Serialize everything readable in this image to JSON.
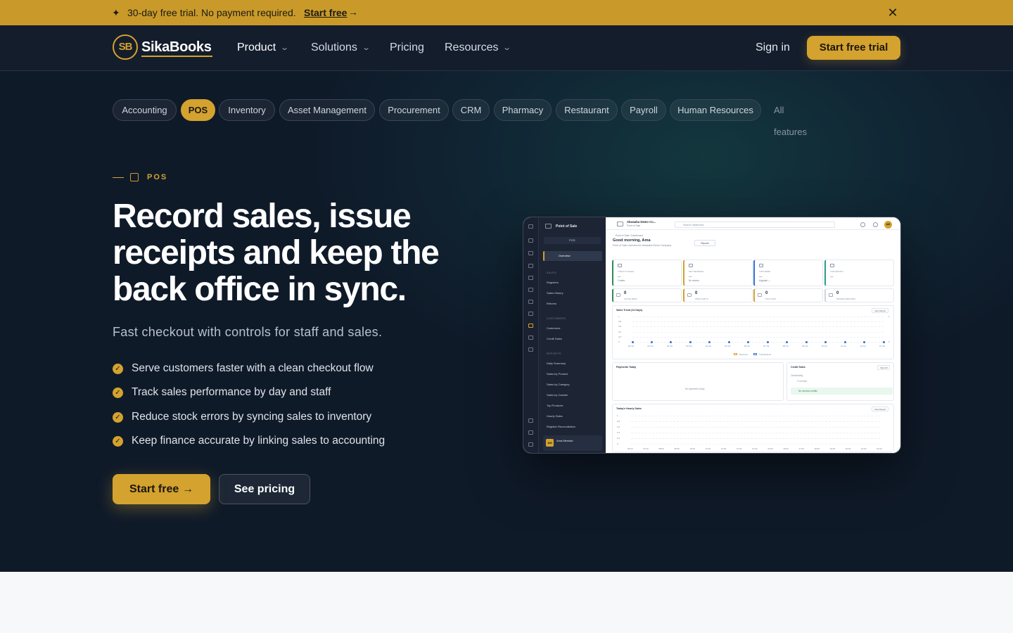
{
  "announcement": {
    "message": "30-day free trial. No payment required.",
    "cta": "Start free",
    "cta_arrow": "→",
    "close_glyph": "✕",
    "spark_glyph": "✦"
  },
  "nav": {
    "logo_mark": "SB",
    "logo_text": "SikaBooks",
    "items": [
      {
        "label": "Product",
        "has_menu": true
      },
      {
        "label": "Solutions",
        "has_menu": true
      },
      {
        "label": "Pricing",
        "has_menu": false
      },
      {
        "label": "Resources",
        "has_menu": true
      }
    ],
    "chevron": "⌄",
    "sign_in": "Sign in",
    "trial": "Start free trial"
  },
  "chips": [
    {
      "label": "Accounting",
      "active": false
    },
    {
      "label": "POS",
      "active": true
    },
    {
      "label": "Inventory",
      "active": false
    },
    {
      "label": "Asset Management",
      "active": false
    },
    {
      "label": "Procurement",
      "active": false
    },
    {
      "label": "CRM",
      "active": false
    },
    {
      "label": "Pharmacy",
      "active": false
    },
    {
      "label": "Restaurant",
      "active": false
    },
    {
      "label": "Payroll",
      "active": false
    },
    {
      "label": "Human Resources",
      "active": false
    }
  ],
  "all_features": "All features",
  "hero": {
    "eyebrow": "POS",
    "headline": "Record sales, issue receipts and keep the back office in sync.",
    "subhead": "Fast checkout with controls for staff and sales.",
    "benefits": [
      "Serve customers faster with a clean checkout flow",
      "Track sales performance by day and staff",
      "Reduce stock errors by syncing sales to inventory",
      "Keep finance accurate by linking sales to accounting"
    ],
    "check_glyph": "✓",
    "primary_cta": "Start free",
    "primary_arrow": "→",
    "secondary_cta": "See pricing"
  },
  "mock": {
    "side_title": "Point of Sale",
    "pos_label": "POS",
    "active_item": "Overview",
    "sections": [
      {
        "title": "SALES",
        "links": [
          "Registers",
          "Sales History",
          "Returns"
        ]
      },
      {
        "title": "CUSTOMERS",
        "links": [
          "Customers",
          "Credit Sales"
        ]
      },
      {
        "title": "REPORTS",
        "links": [
          "Daily Summary",
          "Sales by Product",
          "Sales by Category",
          "Sales by Cashier",
          "Top Products",
          "Hourly Sales",
          "Register Reconciliation"
        ]
      }
    ],
    "user_initials": "AM",
    "user_name": "Ama Mensah",
    "org_name": "Akwaaba Demo Co...",
    "org_sub": "Point of Sale",
    "search": "Search SikaBooks",
    "avatar": "AM",
    "crumb": "Point of Sale / Dashboard",
    "greeting": "Good morning, Ama",
    "greeting_sub": "Point of Sale overview for Akwaaba Demo Company",
    "reports_btn": "Reports",
    "cards": [
      {
        "label": "TODAY'S SALES",
        "value": "—",
        "note": "0 sales",
        "accent": "#2e8b57"
      },
      {
        "label": "NET REVENUE",
        "value": "—",
        "note": "No returns",
        "accent": "#d4a22e"
      },
      {
        "label": "THIS WEEK",
        "value": "—",
        "note": "Avg/sale —",
        "accent": "#2f6fd6"
      },
      {
        "label": "THIS MONTH",
        "value": "—",
        "note": "",
        "accent": "#2a9d8f"
      }
    ],
    "minis": [
      {
        "value": "0",
        "label": "ACTIVE REGS",
        "accent": "#2e8b57"
      },
      {
        "value": "0",
        "label": "OPEN SHIFTS",
        "accent": "#d4a22e"
      },
      {
        "value": "0",
        "label": "POS STAFF",
        "accent": "#d4a22e"
      },
      {
        "value": "0",
        "label": "PENDING REFUNDS",
        "accent": "#cfd5df"
      }
    ],
    "trend_title": "Sales Trend (14 Days)",
    "view_report": "View Report",
    "trend_dates": [
      "09 Jul",
      "01 Jul",
      "02 Jul",
      "03 Jul",
      "04 Jul",
      "05 Jul",
      "06 Jul",
      "07 Jul",
      "08 Jul",
      "09 Jul",
      "10 Jul",
      "11 Jul",
      "12 Jul",
      "13 Jul"
    ],
    "y_ticks": [
      "1",
      "0.8",
      "0.6",
      "0.4",
      "0.2",
      "0"
    ],
    "legend": [
      "Revenue",
      "Transactions"
    ],
    "payments_title": "Payments Today",
    "payments_empty": "No payments today",
    "credit_title": "Credit Sales",
    "view_all": "View All",
    "credit_outstanding": "Outstanding",
    "credit_overdue": "0 overdue",
    "credit_ok": "No overdue credits",
    "hourly_title": "Today's Hourly Sales",
    "hours": [
      "06:00",
      "07:00",
      "08:00",
      "09:00",
      "10:00",
      "11:00",
      "12:00",
      "13:00",
      "14:00",
      "15:00",
      "16:00",
      "17:00",
      "18:00",
      "19:00",
      "20:00",
      "21:00",
      "22:00"
    ]
  }
}
